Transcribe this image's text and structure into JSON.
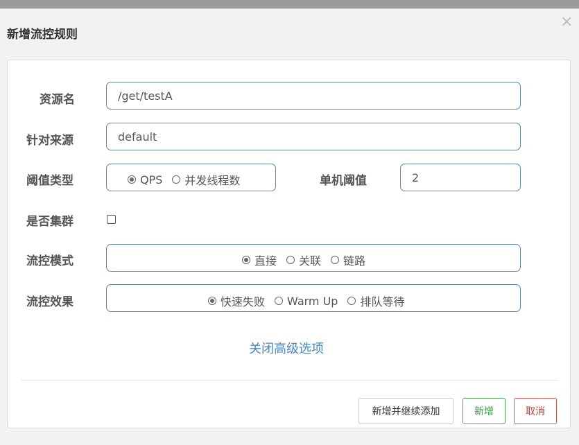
{
  "dialog": {
    "title": "新增流控规则",
    "close_glyph": "×"
  },
  "form": {
    "resource_name": {
      "label": "资源名",
      "value": "/get/testA"
    },
    "limit_app": {
      "label": "针对来源",
      "value": "default"
    },
    "threshold_type": {
      "label": "阈值类型",
      "options": [
        "QPS",
        "并发线程数"
      ],
      "selected": "QPS"
    },
    "single_threshold": {
      "label": "单机阈值",
      "value": "2"
    },
    "cluster": {
      "label": "是否集群",
      "checked": false
    },
    "control_mode": {
      "label": "流控模式",
      "options": [
        "直接",
        "关联",
        "链路"
      ],
      "selected": "直接"
    },
    "control_effect": {
      "label": "流控效果",
      "options": [
        "快速失败",
        "Warm Up",
        "排队等待"
      ],
      "selected": "快速失败"
    },
    "advanced_toggle": "关闭高级选项"
  },
  "footer": {
    "add_continue": "新增并继续添加",
    "add": "新增",
    "cancel": "取消"
  },
  "colors": {
    "border_accent": "#5b89b0",
    "link": "#4a87c1",
    "success": "#4aa352",
    "danger": "#d9534f"
  }
}
